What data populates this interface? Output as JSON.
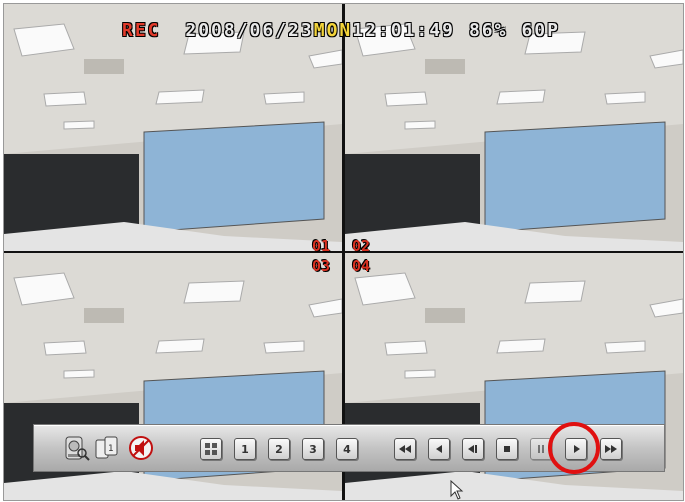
{
  "osd": {
    "rec": "REC",
    "date": "2008/06/23",
    "weekday": "MON",
    "time": "12:01:49",
    "hdd": "86%",
    "mode": "60P"
  },
  "channels": [
    "01",
    "02",
    "03",
    "04"
  ],
  "toolbar": {
    "channel_buttons": [
      "1",
      "2",
      "3",
      "4"
    ],
    "icons": [
      "hdd-search-icon",
      "copy-icon",
      "mute-icon",
      "quad-view-icon",
      "fast-rewind-icon",
      "step-back-icon",
      "slow-back-icon",
      "stop-icon",
      "pause-icon",
      "play-icon",
      "fast-forward-icon"
    ]
  },
  "colors": {
    "rec": "#e23b2b",
    "weekday": "#f3d43a",
    "channel_label": "#d83020",
    "highlight_circle": "#e01010"
  }
}
